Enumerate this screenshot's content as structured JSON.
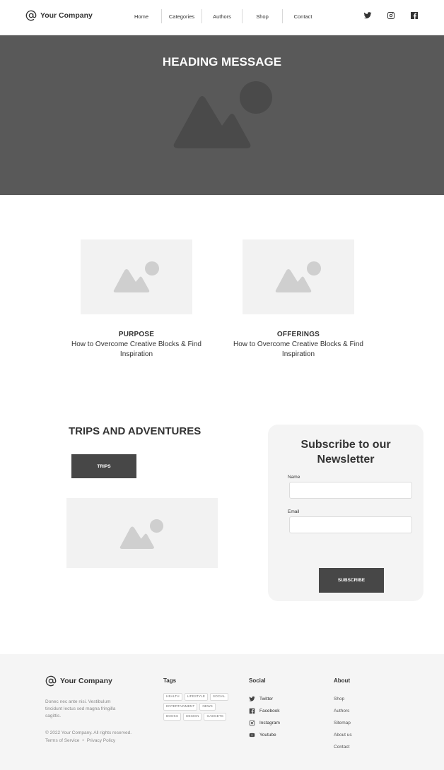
{
  "header": {
    "logo_text": "Your Company",
    "nav": [
      "Home",
      "Categories",
      "Authors",
      "Shop",
      "Contact"
    ],
    "social_icons": [
      "twitter-icon",
      "instagram-icon",
      "facebook-icon"
    ]
  },
  "hero": {
    "title": "HEADING MESSAGE"
  },
  "cards": [
    {
      "title": "PURPOSE",
      "text": "How to Overcome Creative Blocks & Find Inspiration"
    },
    {
      "title": "OFFERINGS",
      "text": "How to Overcome Creative Blocks & Find Inspiration"
    }
  ],
  "trips": {
    "title": "TRIPS AND ADVENTURES",
    "button_label": "TRIPS"
  },
  "newsletter": {
    "title": "Subscribe to our Newsletter",
    "name_label": "Name",
    "email_label": "Email",
    "button_label": "SUBSCRIBE"
  },
  "footer": {
    "logo_text": "Your Company",
    "about_text": "Donec nec ante nisi. Vestibulum tincidunt lectus sed magna fringilla sagittis.",
    "copyright": "© 2022 Your Company.  All rights reserved.",
    "terms": "Terms of Service",
    "separator": "•",
    "privacy": "Privacy Policy",
    "tags_heading": "Tags",
    "tags": [
      "HEALTH",
      "LIFESTYLE",
      "SOCIAL",
      "ENTERTAINMENT",
      "NEWS",
      "BOOKS",
      "DESIGN",
      "GADGETS"
    ],
    "social_heading": "Social",
    "social": [
      {
        "label": "Twitter",
        "icon": "twitter-icon"
      },
      {
        "label": "Facebook",
        "icon": "facebook-icon"
      },
      {
        "label": "Instagram",
        "icon": "instagram-icon"
      },
      {
        "label": "Youtube",
        "icon": "youtube-icon"
      }
    ],
    "about_heading": "About",
    "about_links": [
      "Shop",
      "Authors",
      "Sitemap",
      "About us",
      "Contact"
    ]
  },
  "colors": {
    "hero_bg": "#595959",
    "button_bg": "#474747",
    "placeholder_bg": "#f2f2f2",
    "footer_bg": "#f5f5f5"
  }
}
